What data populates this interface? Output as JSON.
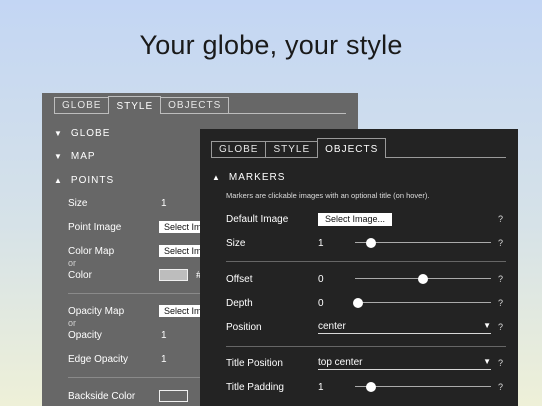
{
  "headline": "Your globe, your style",
  "back_panel": {
    "tabs": [
      "GLOBE",
      "STYLE",
      "OBJECTS"
    ],
    "active_tab": "STYLE",
    "sections": {
      "globe": "GLOBE",
      "map": "MAP",
      "points": "POINTS"
    },
    "rows": {
      "size_label": "Size",
      "size_value": "1",
      "point_image_label": "Point Image",
      "point_image_button": "Select Im",
      "color_map_label": "Color Map",
      "color_map_button": "Select Im",
      "or1": "or",
      "color_label": "Color",
      "color_hash": "#",
      "opacity_map_label": "Opacity Map",
      "opacity_map_button": "Select Im",
      "or2": "or",
      "opacity_label": "Opacity",
      "opacity_value": "1",
      "edge_opacity_label": "Edge Opacity",
      "edge_opacity_value": "1",
      "backside_color_label": "Backside Color"
    },
    "colors": {
      "color_swatch": "#bdbdbd",
      "backside_swatch": "#676767"
    }
  },
  "front_panel": {
    "tabs": [
      "GLOBE",
      "STYLE",
      "OBJECTS"
    ],
    "active_tab": "OBJECTS",
    "section": "MARKERS",
    "description": "Markers are clickable images with an optional title (on hover).",
    "rows": {
      "default_image_label": "Default Image",
      "default_image_button": "Select Image...",
      "size_label": "Size",
      "size_value": "1",
      "size_slider": 0.12,
      "offset_label": "Offset",
      "offset_value": "0",
      "offset_slider": 0.5,
      "depth_label": "Depth",
      "depth_value": "0",
      "depth_slider": 0.02,
      "position_label": "Position",
      "position_value": "center",
      "title_position_label": "Title Position",
      "title_position_value": "top center",
      "title_padding_label": "Title Padding",
      "title_padding_value": "1",
      "title_padding_slider": 0.12
    },
    "help": "?"
  }
}
